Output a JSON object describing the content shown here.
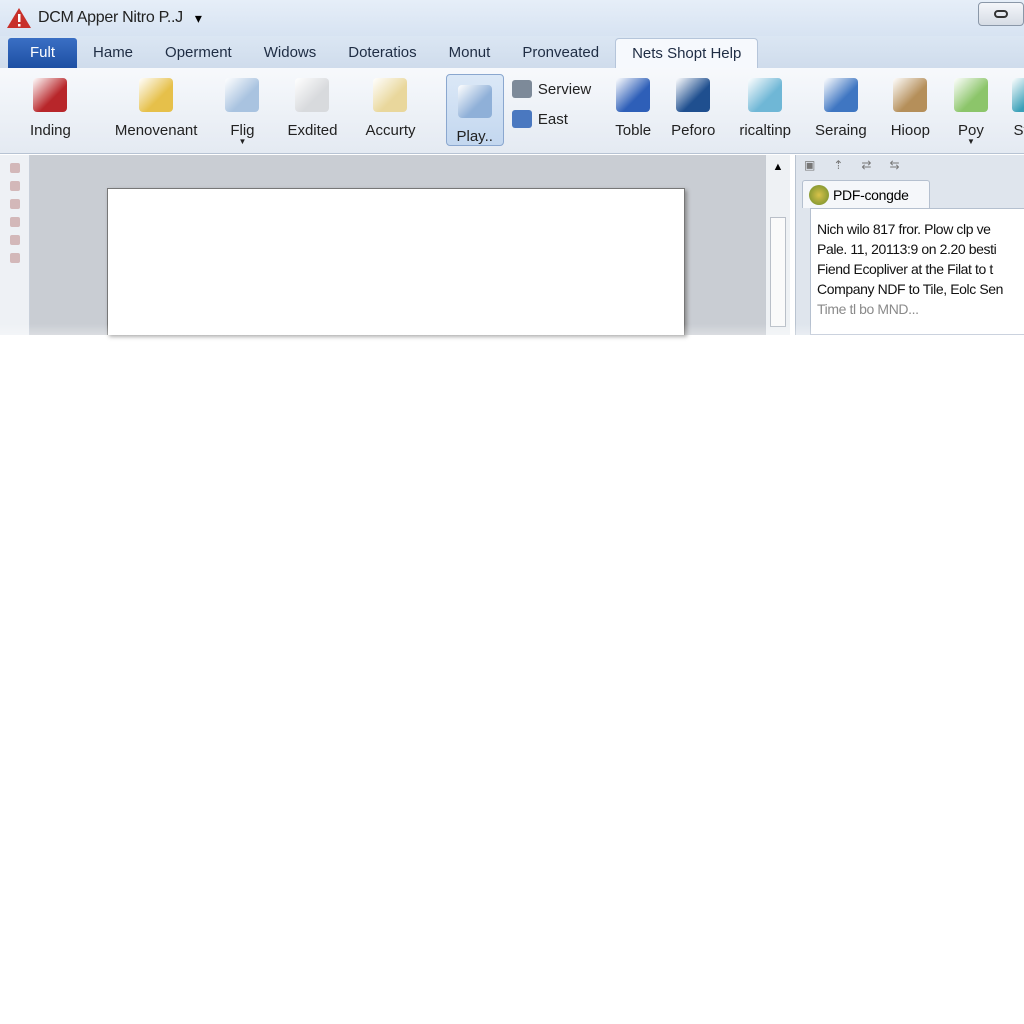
{
  "window": {
    "title": "DCM Apper Nitro P..J",
    "menu_arrow": "▾"
  },
  "tabs": [
    {
      "label": "Fult"
    },
    {
      "label": "Hame"
    },
    {
      "label": "Operment"
    },
    {
      "label": "Widows"
    },
    {
      "label": "Doteratios"
    },
    {
      "label": "Monut"
    },
    {
      "label": "Pronveated"
    },
    {
      "label": "Nets Shopt Help"
    }
  ],
  "ribbon": {
    "left": [
      {
        "label": "Inding",
        "color": "#b8262a"
      },
      {
        "label": "Menovenant",
        "color": "#e6c04a"
      },
      {
        "label": "Flig",
        "color": "#a9c3e0"
      },
      {
        "label": "Exdited",
        "color": "#d8dadd"
      },
      {
        "label": "Accurty",
        "color": "#e9d79c"
      }
    ],
    "selected": {
      "label": "Play..",
      "color": "#8fb0d8"
    },
    "small": [
      {
        "label": "Serview",
        "color": "#7d8a99"
      },
      {
        "label": "East",
        "color": "#4a78c0"
      }
    ],
    "right": [
      {
        "label": "Toble",
        "color": "#2e5fb8"
      },
      {
        "label": "Peforo",
        "color": "#1f4f8f"
      },
      {
        "label": "ricaltinp",
        "color": "#6fb7d6"
      },
      {
        "label": "Seraing",
        "color": "#3f76c2"
      },
      {
        "label": "Hioop",
        "color": "#b58f5a"
      },
      {
        "label": "Poy",
        "color": "#8cc56a"
      },
      {
        "label": "Stop",
        "color": "#3aa0b8"
      }
    ]
  },
  "panel": {
    "tab_label": "PDF-congde",
    "lines": [
      "Nich wilo 817 fror. Plow clp ve",
      "Pale. 11, 20113:9 on 2.20 besti",
      "Fiend Ecopliver at the Filat to t",
      "Company NDF to Tile, Eolc Sen"
    ],
    "faded_line": "Time tl bo MND..."
  }
}
